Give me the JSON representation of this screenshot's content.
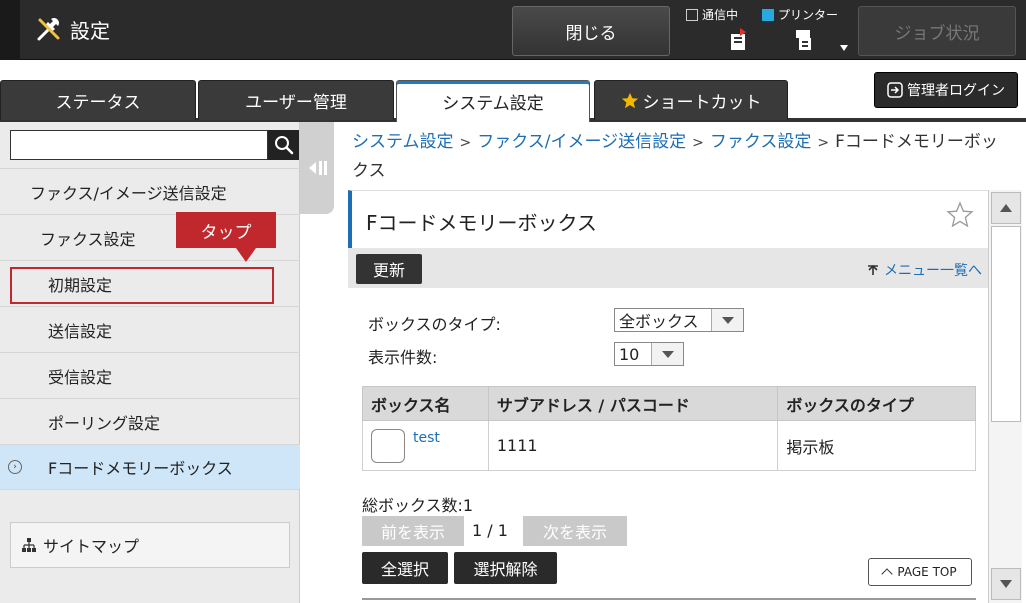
{
  "header": {
    "title": "設定",
    "close_label": "閉じる",
    "status_comm_label": "通信中",
    "status_printer_label": "プリンター",
    "job_status_label": "ジョブ状況",
    "accent_color": "#29a9e0"
  },
  "tabs": [
    {
      "label": "ステータス",
      "active": false
    },
    {
      "label": "ユーザー管理",
      "active": false
    },
    {
      "label": "システム設定",
      "active": true
    },
    {
      "label": "ショートカット",
      "active": false,
      "icon": "star-icon"
    }
  ],
  "admin_login_label": "管理者ログイン",
  "sidebar": {
    "search_placeholder": "",
    "items": [
      {
        "label": "ファクス/イメージ送信設定",
        "level": 1
      },
      {
        "label": "ファクス設定",
        "level": 2
      },
      {
        "label": "初期設定",
        "level": 3
      },
      {
        "label": "送信設定",
        "level": 3
      },
      {
        "label": "受信設定",
        "level": 3
      },
      {
        "label": "ポーリング設定",
        "level": 3
      },
      {
        "label": "Fコードメモリーボックス",
        "level": 3,
        "active": true
      }
    ],
    "sitemap_label": "サイトマップ"
  },
  "callout": {
    "label": "タップ",
    "color": "#c0282d"
  },
  "breadcrumb": {
    "items": [
      "システム設定",
      "ファクス/イメージ送信設定",
      "ファクス設定"
    ],
    "current": "Fコードメモリーボックス",
    "separator": ">"
  },
  "main": {
    "title": "Fコードメモリーボックス",
    "refresh_label": "更新",
    "menu_list_label": "メニュー一覧へ",
    "box_type_label": "ボックスのタイプ:",
    "box_type_value": "全ボックス",
    "display_count_label": "表示件数:",
    "display_count_value": "10",
    "table": {
      "headers": [
        "ボックス名",
        "サブアドレス / パスコード",
        "ボックスのタイプ"
      ],
      "rows": [
        {
          "name": "test",
          "subaddress": "1111",
          "type": "掲示板"
        }
      ]
    },
    "total_label": "総ボックス数:1",
    "prev_label": "前を表示",
    "page_indicator": "1 / 1",
    "next_label": "次を表示",
    "select_all_label": "全選択",
    "deselect_label": "選択解除",
    "page_top_label": "PAGE TOP"
  }
}
